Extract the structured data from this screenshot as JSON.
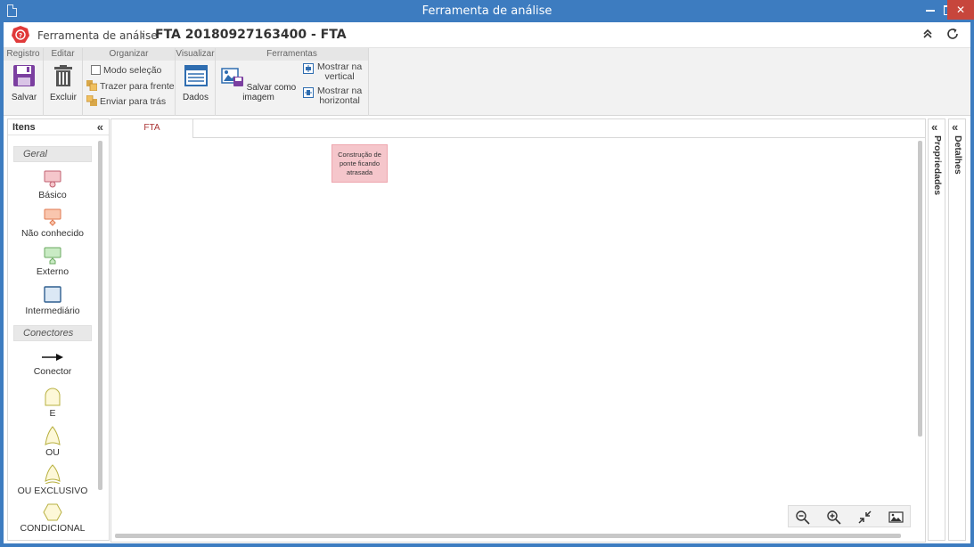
{
  "window": {
    "title": "Ferramenta de análise"
  },
  "header": {
    "app_name": "Ferramenta de análise",
    "separator": "›",
    "document_title": "FTA 20180927163400 - FTA"
  },
  "ribbon": {
    "groups": [
      {
        "label": "Registro",
        "buttons": [
          {
            "label": "Salvar",
            "icon": "save-icon"
          }
        ]
      },
      {
        "label": "Editar",
        "buttons": [
          {
            "label": "Excluir",
            "icon": "trash-icon"
          }
        ]
      },
      {
        "label": "Organizar",
        "buttons": [
          {
            "label": "Modo seleção",
            "icon": "checkbox-icon",
            "checked": false
          },
          {
            "label": "Trazer para frente",
            "icon": "bring-front-icon"
          },
          {
            "label": "Enviar para trás",
            "icon": "send-back-icon"
          }
        ]
      },
      {
        "label": "Visualizar",
        "buttons": [
          {
            "label": "Dados",
            "icon": "data-grid-icon"
          }
        ]
      },
      {
        "label": "Ferramentas",
        "buttons": [
          {
            "label": "Salvar como imagem",
            "icon": "save-image-icon"
          },
          {
            "label_line1": "Mostrar na",
            "label_line2": "vertical",
            "icon": "vertical-layout-icon"
          },
          {
            "label_line1": "Mostrar na",
            "label_line2": "horizontal",
            "icon": "horizontal-layout-icon"
          }
        ]
      }
    ]
  },
  "left_panel": {
    "title": "Itens",
    "collapse": "«",
    "sections": [
      {
        "label": "Geral",
        "items": [
          "Básico",
          "Não conhecido",
          "Externo",
          "Intermediário"
        ]
      },
      {
        "label": "Conectores",
        "items": [
          "Conector",
          "E",
          "OU",
          "OU EXCLUSIVO",
          "CONDICIONAL"
        ]
      }
    ]
  },
  "canvas": {
    "tabs": [
      "FTA"
    ],
    "nodes": [
      {
        "text_lines": [
          "Construção de",
          "ponte ficando",
          "atrasada"
        ],
        "type": "Básico"
      }
    ]
  },
  "right_panels": [
    {
      "label": "Propriedades",
      "expand": "«"
    },
    {
      "label": "Detalhes",
      "expand": "«"
    }
  ],
  "colors": {
    "titlebar": "#3d7cc0",
    "close_button": "#c7463c",
    "event_fill": "#f5c6cb",
    "brand": "#e03a3a"
  }
}
